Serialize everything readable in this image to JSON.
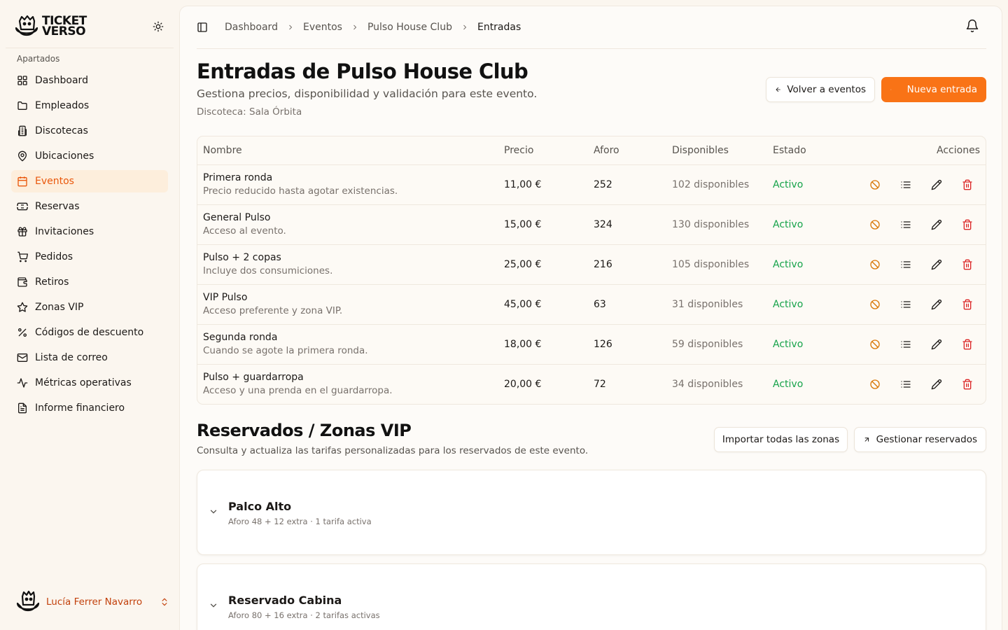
{
  "brand": {
    "line1": "TICKET",
    "line2": "VERSO"
  },
  "sidebar": {
    "group_label": "Apartados",
    "items": [
      {
        "label": "Dashboard",
        "icon": "dashboard-icon"
      },
      {
        "label": "Empleados",
        "icon": "folder-icon"
      },
      {
        "label": "Discotecas",
        "icon": "building-icon"
      },
      {
        "label": "Ubicaciones",
        "icon": "map-pin-icon"
      },
      {
        "label": "Eventos",
        "icon": "calendar-icon",
        "active": true
      },
      {
        "label": "Reservas",
        "icon": "ticket-icon"
      },
      {
        "label": "Invitaciones",
        "icon": "gift-icon"
      },
      {
        "label": "Pedidos",
        "icon": "cart-icon"
      },
      {
        "label": "Retiros",
        "icon": "wallet-icon"
      },
      {
        "label": "Zonas VIP",
        "icon": "star-icon"
      },
      {
        "label": "Códigos de descuento",
        "icon": "percent-icon"
      },
      {
        "label": "Lista de correo",
        "icon": "mail-icon"
      },
      {
        "label": "Métricas operativas",
        "icon": "activity-icon"
      },
      {
        "label": "Informe financiero",
        "icon": "report-icon"
      }
    ],
    "user_name": "Lucía Ferrer Navarro"
  },
  "breadcrumb": [
    "Dashboard",
    "Eventos",
    "Pulso House Club",
    "Entradas"
  ],
  "page": {
    "title": "Entradas de Pulso House Club",
    "subtitle": "Gestiona precios, disponibilidad y validación para este evento.",
    "meta": "Discoteca: Sala Órbita",
    "back_button": "Volver a eventos",
    "new_button": "Nueva entrada"
  },
  "table": {
    "headers": {
      "name": "Nombre",
      "price": "Precio",
      "aforo": "Aforo",
      "available": "Disponibles",
      "status": "Estado",
      "actions": "Acciones"
    },
    "rows": [
      {
        "name": "Primera ronda",
        "desc": "Precio reducido hasta agotar existencias.",
        "price": "11,00 €",
        "aforo": "252",
        "available": "102 disponibles",
        "status": "Activo"
      },
      {
        "name": "General Pulso",
        "desc": "Acceso al evento.",
        "price": "15,00 €",
        "aforo": "324",
        "available": "130 disponibles",
        "status": "Activo"
      },
      {
        "name": "Pulso + 2 copas",
        "desc": "Incluye dos consumiciones.",
        "price": "25,00 €",
        "aforo": "216",
        "available": "105 disponibles",
        "status": "Activo"
      },
      {
        "name": "VIP Pulso",
        "desc": "Acceso preferente y zona VIP.",
        "price": "45,00 €",
        "aforo": "63",
        "available": "31 disponibles",
        "status": "Activo"
      },
      {
        "name": "Segunda ronda",
        "desc": "Cuando se agote la primera ronda.",
        "price": "18,00 €",
        "aforo": "126",
        "available": "59 disponibles",
        "status": "Activo"
      },
      {
        "name": "Pulso + guardarropa",
        "desc": "Acceso y una prenda en el guardarropa.",
        "price": "20,00 €",
        "aforo": "72",
        "available": "34 disponibles",
        "status": "Activo"
      }
    ]
  },
  "reservados": {
    "title": "Reservados / Zonas VIP",
    "subtitle": "Consulta y actualiza las tarifas personalizadas para los reservados de este evento.",
    "import_button": "Importar todas las zonas",
    "manage_button": "Gestionar reservados",
    "zones": [
      {
        "name": "Palco Alto",
        "meta": "Aforo 48 + 12 extra · 1 tarifa activa"
      },
      {
        "name": "Reservado Cabina",
        "meta": "Aforo 80 + 16 extra · 2 tarifas activas"
      }
    ]
  },
  "colors": {
    "accent": "#f97316",
    "active_status": "#16a34a",
    "delete": "#dc2626",
    "disable": "#d97706"
  }
}
